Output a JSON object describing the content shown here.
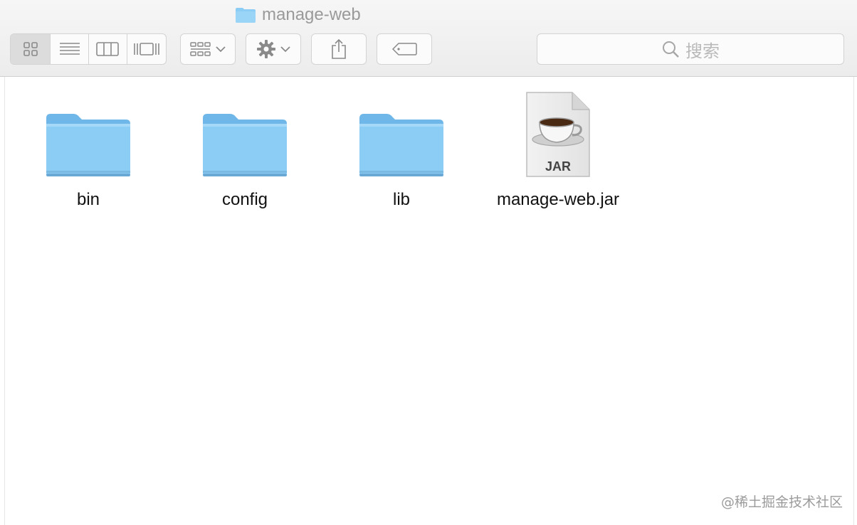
{
  "window": {
    "title": "manage-web"
  },
  "toolbar": {
    "view_modes": [
      {
        "name": "icon-view",
        "icon": "grid-icon",
        "active": true
      },
      {
        "name": "list-view",
        "icon": "list-icon",
        "active": false
      },
      {
        "name": "column-view",
        "icon": "columns-icon",
        "active": false
      },
      {
        "name": "coverflow-view",
        "icon": "coverflow-icon",
        "active": false
      }
    ],
    "arrange_icon": "arrange-grid-icon",
    "action_icon": "gear-icon",
    "share_icon": "share-icon",
    "tag_icon": "tag-icon"
  },
  "search": {
    "placeholder": "搜索"
  },
  "files": [
    {
      "name": "bin",
      "type": "folder"
    },
    {
      "name": "config",
      "type": "folder"
    },
    {
      "name": "lib",
      "type": "folder"
    },
    {
      "name": "manage-web.jar",
      "type": "jar",
      "badge": "JAR"
    }
  ],
  "watermark": "@稀土掘金技术社区",
  "colors": {
    "folder": "#8ccdf5",
    "folder_dark": "#6fb7e8",
    "toolbar_icon": "#8a8a8a"
  }
}
